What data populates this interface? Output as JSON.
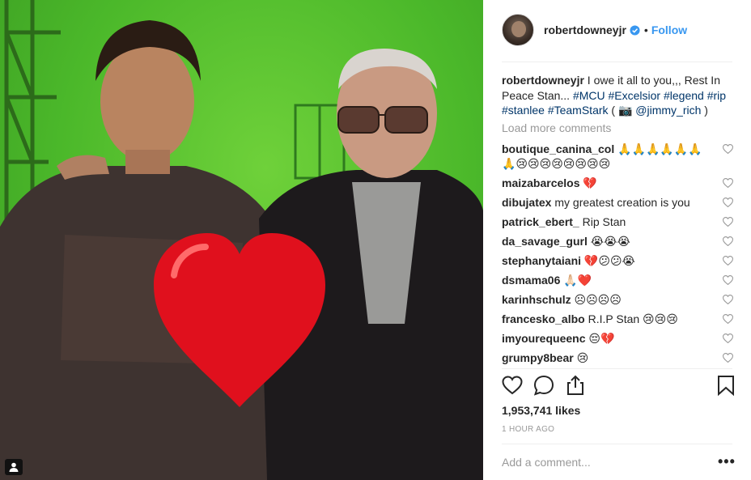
{
  "post": {
    "username": "robertdowneyj r",
    "follow_label": "Follow",
    "dot": "•",
    "caption_user": "robertdowneyjr",
    "caption_text_1": "I owe it all to you,,, Rest In Peace Stan...",
    "caption_tags": [
      "#MCU",
      "#Excelsior",
      "#legend",
      "#rip",
      "#stanlee",
      "#TeamStark"
    ],
    "caption_credit_open": "( 📷",
    "caption_mention": "@jimmy_rich",
    "caption_credit_close": ")",
    "load_more": "Load more comments",
    "likes": "1,953,741 likes",
    "time": "1 HOUR AGO",
    "add_comment_placeholder": "Add a comment...",
    "more": "•••"
  },
  "comments": [
    {
      "user": "boutique_canina_col",
      "text": "🙏🙏🙏🙏🙏🙏🙏😢😢😢😢😢😢😢😢"
    },
    {
      "user": "maizabarcelos",
      "text": "💔"
    },
    {
      "user": "dibujatex",
      "text": "my greatest creation is you"
    },
    {
      "user": "patrick_ebert_",
      "text": "Rip Stan"
    },
    {
      "user": "da_savage_gurl",
      "text": "😭😭😭"
    },
    {
      "user": "stephanytaiani",
      "text": "💔😕😕😭"
    },
    {
      "user": "dsmama06",
      "text": "🙏🏻❤️"
    },
    {
      "user": "karinhschulz",
      "text": "☹☹☹☹"
    },
    {
      "user": "francesko_albo",
      "text": "R.I.P Stan 😢😢😢"
    },
    {
      "user": "imyourequeenc",
      "text": "😔💔"
    },
    {
      "user": "grumpy8bear",
      "text": "😢"
    }
  ],
  "icons": {
    "like": "heart-outline-icon",
    "comment": "speech-bubble-icon",
    "share": "share-icon",
    "save": "bookmark-icon",
    "verified": "verified-badge-icon",
    "tagged": "person-tag-icon"
  },
  "colors": {
    "link": "#3897f0",
    "hashtag": "#003569",
    "muted": "#999999",
    "heart_overlay": "#e0101d",
    "green_screen": "#4bb82a"
  }
}
